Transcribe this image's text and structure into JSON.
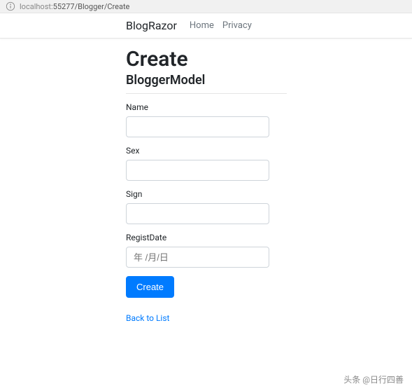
{
  "addressbar": {
    "host": "localhost:",
    "port": "55277",
    "path": "/Blogger/Create"
  },
  "nav": {
    "brand": "BlogRazor",
    "links": [
      "Home",
      "Privacy"
    ]
  },
  "page": {
    "title": "Create",
    "subtitle": "BloggerModel"
  },
  "form": {
    "name": {
      "label": "Name",
      "value": ""
    },
    "sex": {
      "label": "Sex",
      "value": ""
    },
    "sign": {
      "label": "Sign",
      "value": ""
    },
    "registDate": {
      "label": "RegistDate",
      "placeholder": "年 /月/日",
      "value": ""
    },
    "submit": "Create"
  },
  "links": {
    "back": "Back to List"
  },
  "watermark": "头条 @日行四善"
}
